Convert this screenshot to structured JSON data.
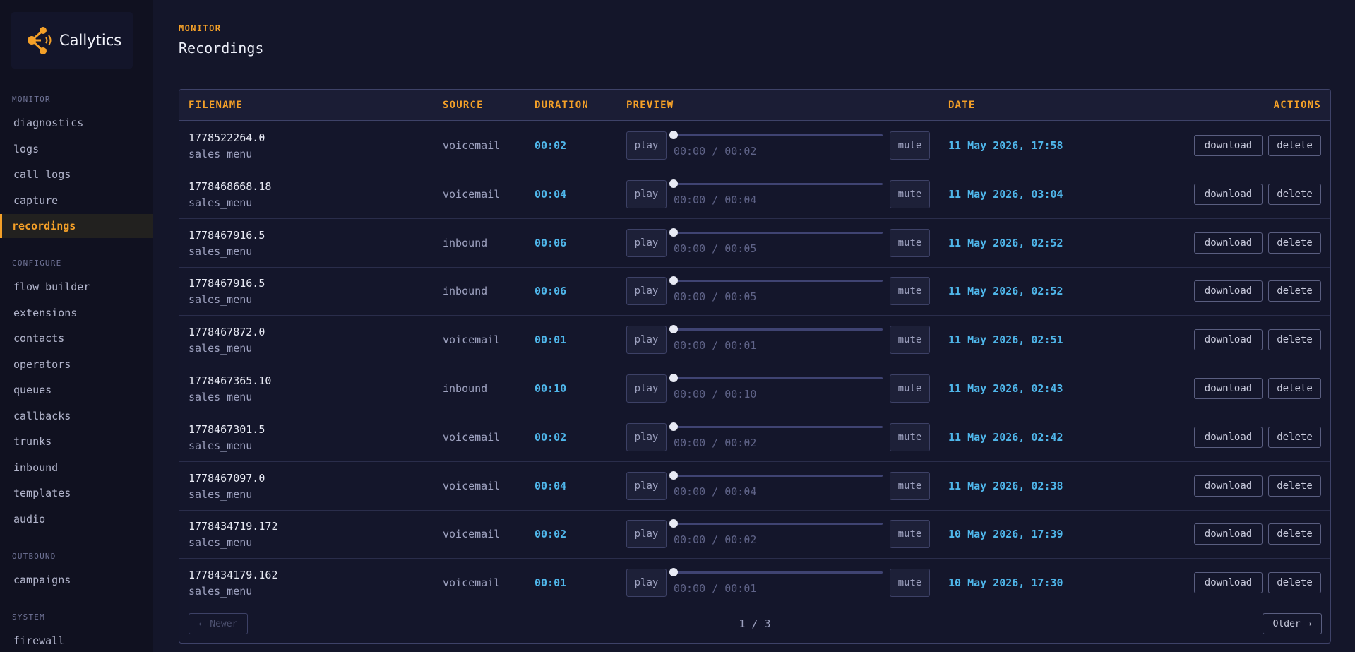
{
  "app": {
    "name": "Callytics",
    "accent": "#f4a028",
    "link_color": "#4fb6ea"
  },
  "sidebar": {
    "sections": [
      {
        "label": "MONITOR",
        "items": [
          "diagnostics",
          "logs",
          "call logs",
          "capture",
          "recordings"
        ]
      },
      {
        "label": "CONFIGURE",
        "items": [
          "flow builder",
          "extensions",
          "contacts",
          "operators",
          "queues",
          "callbacks",
          "trunks",
          "inbound",
          "templates",
          "audio"
        ]
      },
      {
        "label": "OUTBOUND",
        "items": [
          "campaigns"
        ]
      },
      {
        "label": "SYSTEM",
        "items": [
          "firewall"
        ]
      }
    ],
    "active": "recordings"
  },
  "page": {
    "eyebrow": "MONITOR",
    "title": "Recordings"
  },
  "table": {
    "columns": [
      "FILENAME",
      "SOURCE",
      "DURATION",
      "PREVIEW",
      "DATE",
      "ACTIONS"
    ],
    "play_label": "play",
    "mute_label": "mute",
    "download_label": "download",
    "delete_label": "delete",
    "rows": [
      {
        "filename": "1778522264.0",
        "sub": "sales_menu",
        "source": "voicemail",
        "duration": "00:02",
        "time": "00:00 / 00:02",
        "date": "11 May 2026, 17:58"
      },
      {
        "filename": "1778468668.18",
        "sub": "sales_menu",
        "source": "voicemail",
        "duration": "00:04",
        "time": "00:00 / 00:04",
        "date": "11 May 2026, 03:04"
      },
      {
        "filename": "1778467916.5",
        "sub": "sales_menu",
        "source": "inbound",
        "duration": "00:06",
        "time": "00:00 / 00:05",
        "date": "11 May 2026, 02:52"
      },
      {
        "filename": "1778467916.5",
        "sub": "sales_menu",
        "source": "inbound",
        "duration": "00:06",
        "time": "00:00 / 00:05",
        "date": "11 May 2026, 02:52"
      },
      {
        "filename": "1778467872.0",
        "sub": "sales_menu",
        "source": "voicemail",
        "duration": "00:01",
        "time": "00:00 / 00:01",
        "date": "11 May 2026, 02:51"
      },
      {
        "filename": "1778467365.10",
        "sub": "sales_menu",
        "source": "inbound",
        "duration": "00:10",
        "time": "00:00 / 00:10",
        "date": "11 May 2026, 02:43"
      },
      {
        "filename": "1778467301.5",
        "sub": "sales_menu",
        "source": "voicemail",
        "duration": "00:02",
        "time": "00:00 / 00:02",
        "date": "11 May 2026, 02:42"
      },
      {
        "filename": "1778467097.0",
        "sub": "sales_menu",
        "source": "voicemail",
        "duration": "00:04",
        "time": "00:00 / 00:04",
        "date": "11 May 2026, 02:38"
      },
      {
        "filename": "1778434719.172",
        "sub": "sales_menu",
        "source": "voicemail",
        "duration": "00:02",
        "time": "00:00 / 00:02",
        "date": "10 May 2026, 17:39"
      },
      {
        "filename": "1778434179.162",
        "sub": "sales_menu",
        "source": "voicemail",
        "duration": "00:01",
        "time": "00:00 / 00:01",
        "date": "10 May 2026, 17:30"
      }
    ]
  },
  "pagination": {
    "newer_label": "← Newer",
    "older_label": "Older →",
    "info": "1 / 3"
  }
}
